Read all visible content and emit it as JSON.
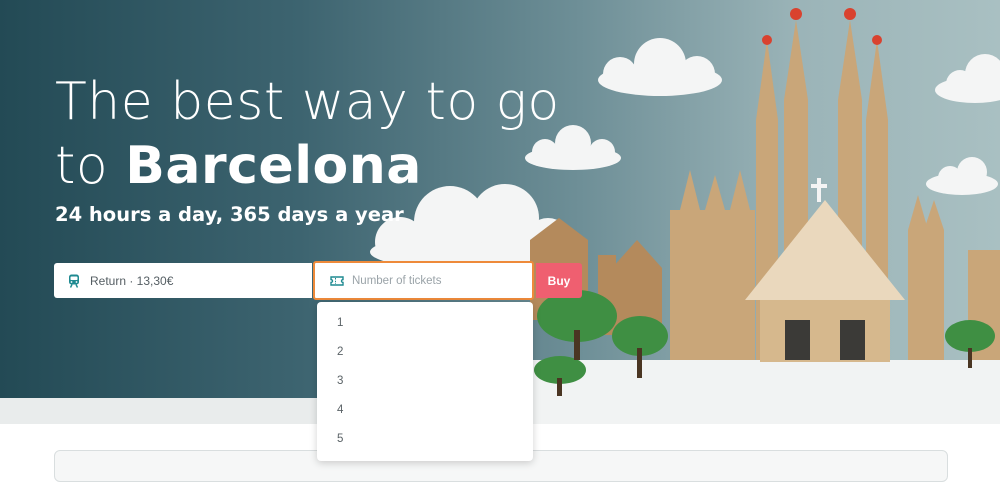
{
  "hero": {
    "title_line1": "The best way to go",
    "title_prefix": "to ",
    "title_city": "Barcelona",
    "subtitle": "24 hours a day, 365 days a year"
  },
  "form": {
    "ticket_type": {
      "icon": "train-icon",
      "value": "Return · 13,30€"
    },
    "quantity": {
      "icon": "ticket-icon",
      "placeholder": "Number of tickets"
    },
    "buy_label": "Buy",
    "dropdown_options": [
      "1",
      "2",
      "3",
      "4",
      "5"
    ]
  },
  "colors": {
    "accent_focus": "#ee8a3a",
    "buy_button": "#ef5f70",
    "hero_background": "#3d6470"
  }
}
